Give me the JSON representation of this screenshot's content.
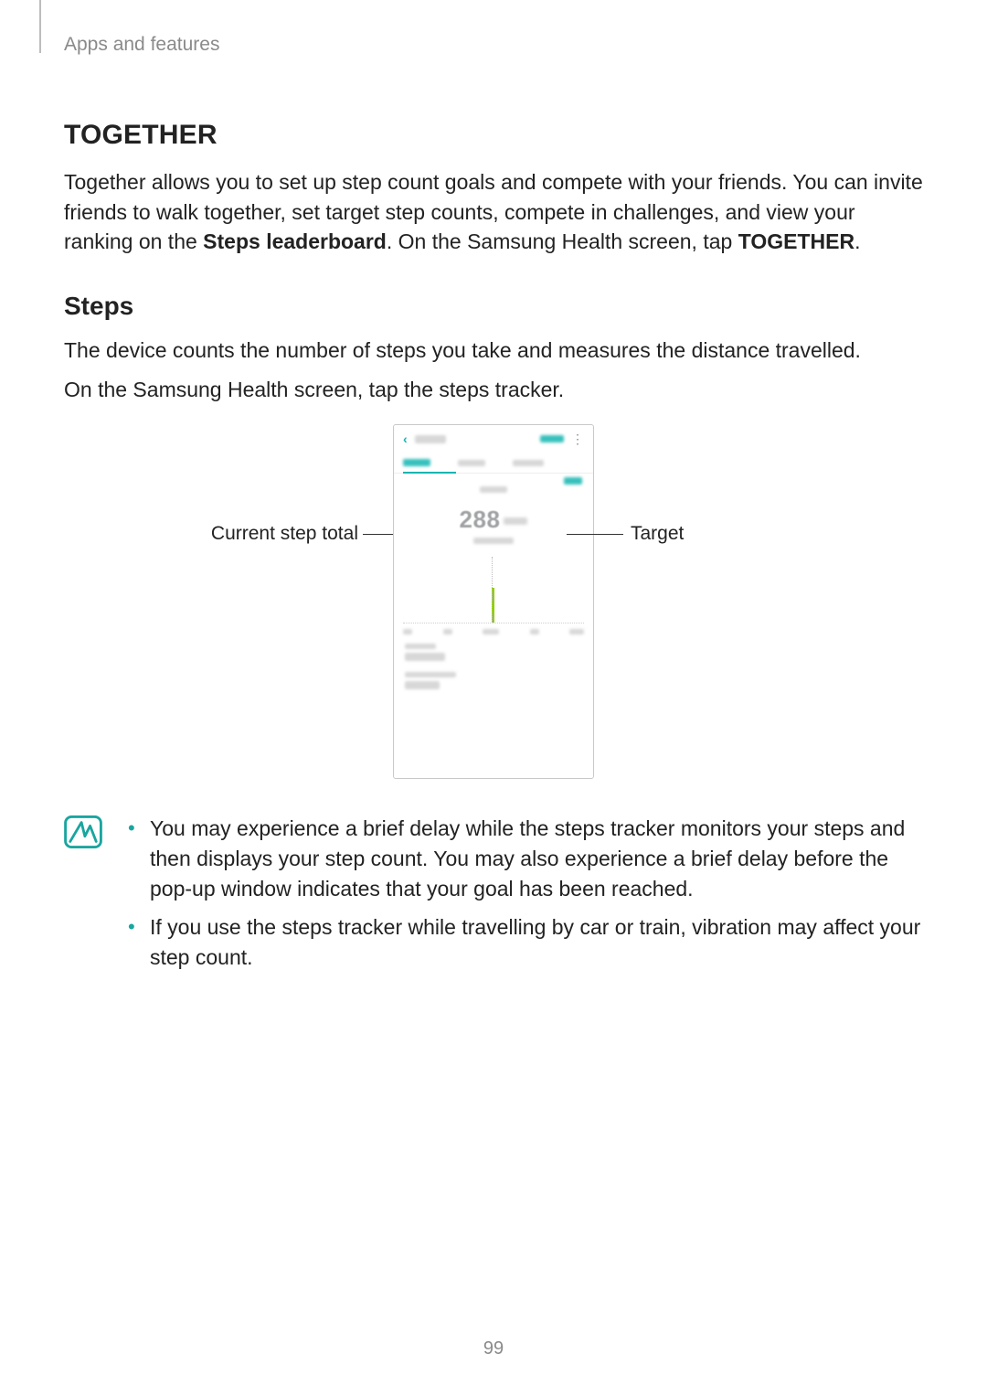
{
  "header": {
    "breadcrumb": "Apps and features"
  },
  "section_together": {
    "heading": "TOGETHER",
    "para_before_bold1": "Together allows you to set up step count goals and compete with your friends. You can invite friends to walk together, set target step counts, compete in challenges, and view your ranking on the ",
    "bold1": "Steps leaderboard",
    "para_mid": ". On the Samsung Health screen, tap ",
    "bold2": "TOGETHER",
    "para_end": "."
  },
  "section_steps": {
    "heading": "Steps",
    "para1": "The device counts the number of steps you take and measures the distance travelled.",
    "para2": "On the Samsung Health screen, tap the steps tracker."
  },
  "figure": {
    "callout_left": "Current step total",
    "callout_right": "Target",
    "step_value": "288"
  },
  "notes": {
    "item1": "You may experience a brief delay while the steps tracker monitors your steps and then displays your step count. You may also experience a brief delay before the pop-up window indicates that your goal has been reached.",
    "item2": "If you use the steps tracker while travelling by car or train, vibration may affect your step count."
  },
  "page_number": "99"
}
